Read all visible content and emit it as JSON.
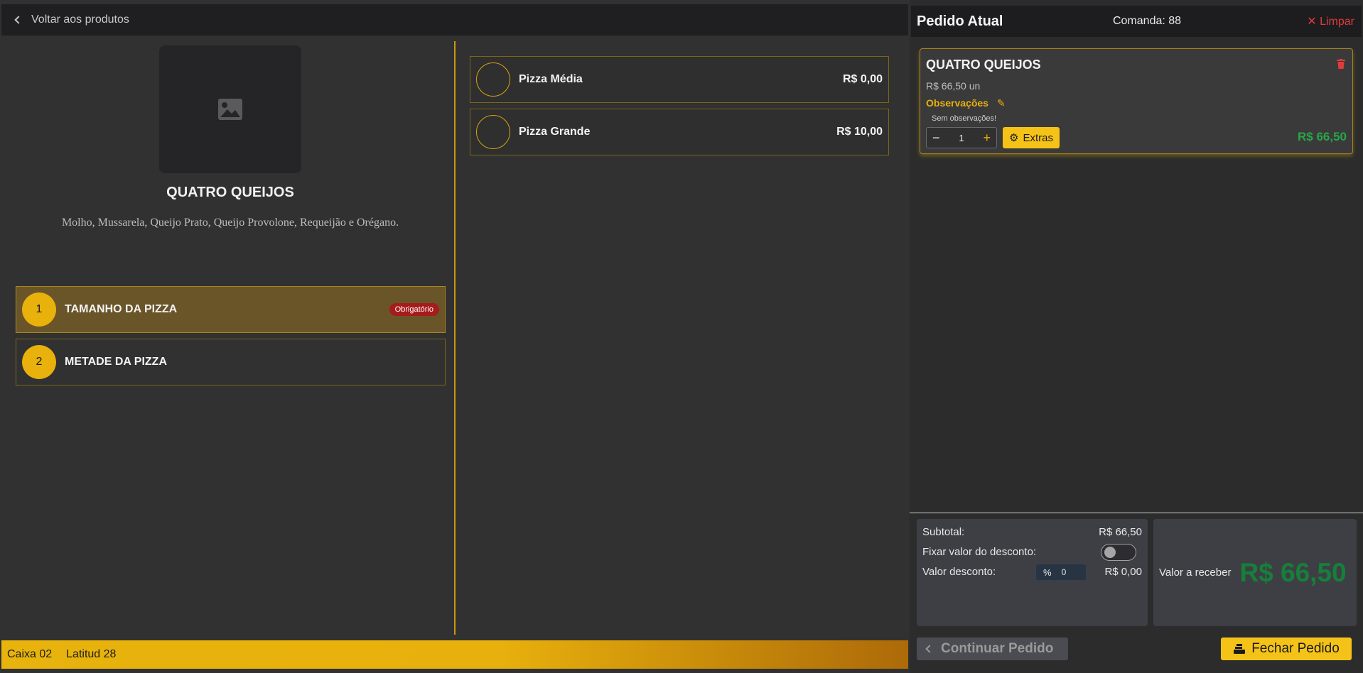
{
  "left": {
    "back_label": "Voltar aos produtos",
    "product": {
      "name": "QUATRO QUEIJOS",
      "description": "Molho, Mussarela, Queijo Prato, Queijo Provolone, Requeijão e Orégano."
    },
    "steps": [
      {
        "number": "1",
        "label": "TAMANHO DA PIZZA",
        "badge": "Obrigatório",
        "active": true
      },
      {
        "number": "2",
        "label": "METADE DA PIZZA",
        "active": false
      }
    ],
    "options": [
      {
        "name": "Pizza Média",
        "price": "R$ 0,00"
      },
      {
        "name": "Pizza Grande",
        "price": "R$ 10,00"
      }
    ],
    "footer": {
      "caixa": "Caixa 02",
      "user": "Latitud 28"
    }
  },
  "right": {
    "title": "Pedido Atual",
    "comanda": "Comanda: 88",
    "clear_label": "Limpar",
    "item": {
      "name": "QUATRO QUEIJOS",
      "unit_price": "R$ 66,50 un",
      "obs_label": "Observações",
      "obs_text": "Sem observações!",
      "quantity": "1",
      "extras_label": "Extras",
      "total": "R$ 66,50"
    },
    "summary": {
      "subtotal_label": "Subtotal:",
      "subtotal_value": "R$ 66,50",
      "fix_discount_label": "Fixar valor do desconto:",
      "discount_label": "Valor desconto:",
      "discount_symbol": "%",
      "discount_input": "0",
      "discount_value": "R$ 0,00"
    },
    "receive": {
      "label": "Valor a receber",
      "value": "R$ 66,50"
    },
    "continue_label": "Continuar Pedido",
    "close_label": "Fechar Pedido"
  },
  "colors": {
    "accent": "#e8b10b",
    "success": "#28a745",
    "danger": "#e03b3b"
  }
}
